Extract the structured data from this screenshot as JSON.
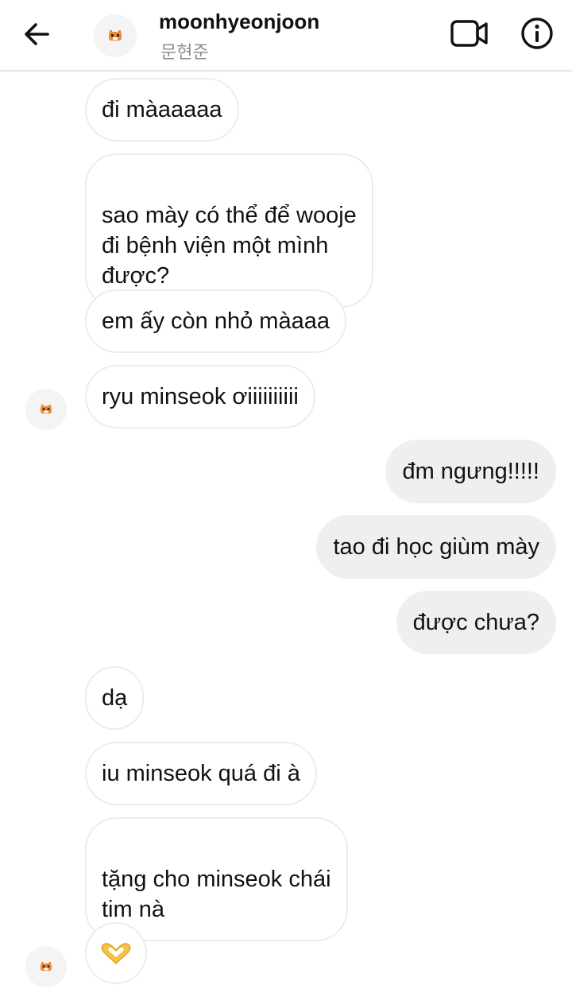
{
  "header": {
    "username": "moonhyeonjoon",
    "subname": "문현준"
  },
  "messages": [
    {
      "text": "đi màaaaaa",
      "side": "in"
    },
    {
      "text": "sao mày có thể để wooje\nđi bệnh viện một mình\nđược?",
      "side": "in"
    },
    {
      "text": "em ấy còn nhỏ màaaa",
      "side": "in"
    },
    {
      "text": "ryu minseok ơiiiiiiiiii",
      "side": "in"
    },
    {
      "text": "đm ngưng!!!!!",
      "side": "out"
    },
    {
      "text": "tao đi học giùm mày",
      "side": "out"
    },
    {
      "text": "được chưa?",
      "side": "out"
    },
    {
      "text": "dạ",
      "side": "in"
    },
    {
      "text": "iu minseok quá đi à",
      "side": "in"
    },
    {
      "text": "tặng cho minseok chái\ntim nà",
      "side": "in"
    },
    {
      "text": "🫶",
      "side": "in",
      "icon": "heart-hands-emoji"
    }
  ],
  "colors": {
    "incoming_bubble_border": "#ececec",
    "outgoing_bubble_bg": "#efefef",
    "emoji_yellow": "#f6c244"
  }
}
